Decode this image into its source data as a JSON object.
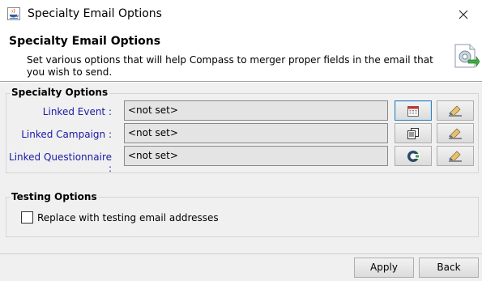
{
  "window": {
    "title": "Specialty Email Options"
  },
  "header": {
    "title": "Specialty Email Options",
    "description": "Set various options that will help Compass to merger proper fields in the email that you wish to send."
  },
  "specialty": {
    "group_title": "Specialty Options",
    "rows": [
      {
        "label": "Linked Event :",
        "value": "<not set>"
      },
      {
        "label": "Linked Campaign :",
        "value": "<not set>"
      },
      {
        "label": "Linked Questionnaire :",
        "value": "<not set>"
      }
    ]
  },
  "testing": {
    "group_title": "Testing Options",
    "replace_label": "Replace with testing email addresses",
    "replace_checked": false
  },
  "buttons": {
    "apply": "Apply",
    "back": "Back"
  },
  "colors": {
    "label_blue": "#1a1aa6",
    "field_bg": "#e4e4e4"
  }
}
